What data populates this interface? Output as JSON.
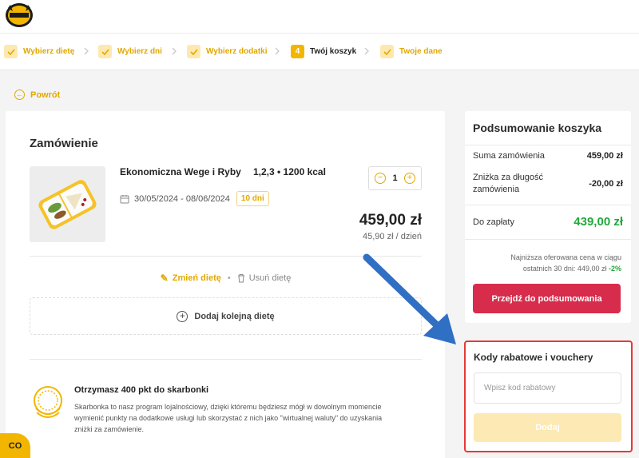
{
  "steps": [
    {
      "label": "Wybierz dietę",
      "state": "done"
    },
    {
      "label": "Wybierz dni",
      "state": "done"
    },
    {
      "label": "Wybierz dodatki",
      "state": "done"
    },
    {
      "label": "Twój koszyk",
      "state": "active",
      "number": "4"
    },
    {
      "label": "Twoje dane",
      "state": "done"
    }
  ],
  "back_label": "Powrót",
  "order": {
    "title": "Zamówienie",
    "product_name": "Ekonomiczna Wege i Ryby",
    "meta": "1,2,3 • 1200 kcal",
    "dates": "30/05/2024 - 08/06/2024",
    "days_badge": "10 dni",
    "quantity": "1",
    "price": "459,00 zł",
    "per_day": "45,90 zł / dzień",
    "edit_label": "Zmień dietę",
    "delete_label": "Usuń dietę",
    "add_diet_label": "Dodaj kolejną dietę"
  },
  "loyalty": {
    "title": "Otrzymasz 400 pkt do skarbonki",
    "text": "Skarbonka to nasz program lojalnościowy, dzięki któremu będziesz mógł w dowolnym momencie wymienić punkty na dodatkowe usługi lub skorzystać z nich jako \"wirtualnej waluty\" do uzyskania zniżki za zamówienie."
  },
  "summary": {
    "title": "Podsumowanie koszyka",
    "order_sum_label": "Suma zamówienia",
    "order_sum_value": "459,00 zł",
    "discount_label": "Zniżka za długość zamówienia",
    "discount_value": "-20,00 zł",
    "total_label": "Do zapłaty",
    "total_value": "439,00 zł",
    "lowest_price_note": "Najniższa oferowana cena w ciągu ostatnich 30 dni: 449,00 zł",
    "lowest_price_pct": "-2%",
    "proceed_button": "Przejdź do podsumowania"
  },
  "codes": {
    "title": "Kody rabatowe i vouchery",
    "placeholder": "Wpisz kod rabatowy",
    "add_button": "Dodaj"
  },
  "chat_label": "CO",
  "colors": {
    "accent": "#f2b600",
    "primary_button": "#d72c4b",
    "success": "#22a83a",
    "highlight_border": "#e53935",
    "arrow": "#2f6fc4"
  }
}
